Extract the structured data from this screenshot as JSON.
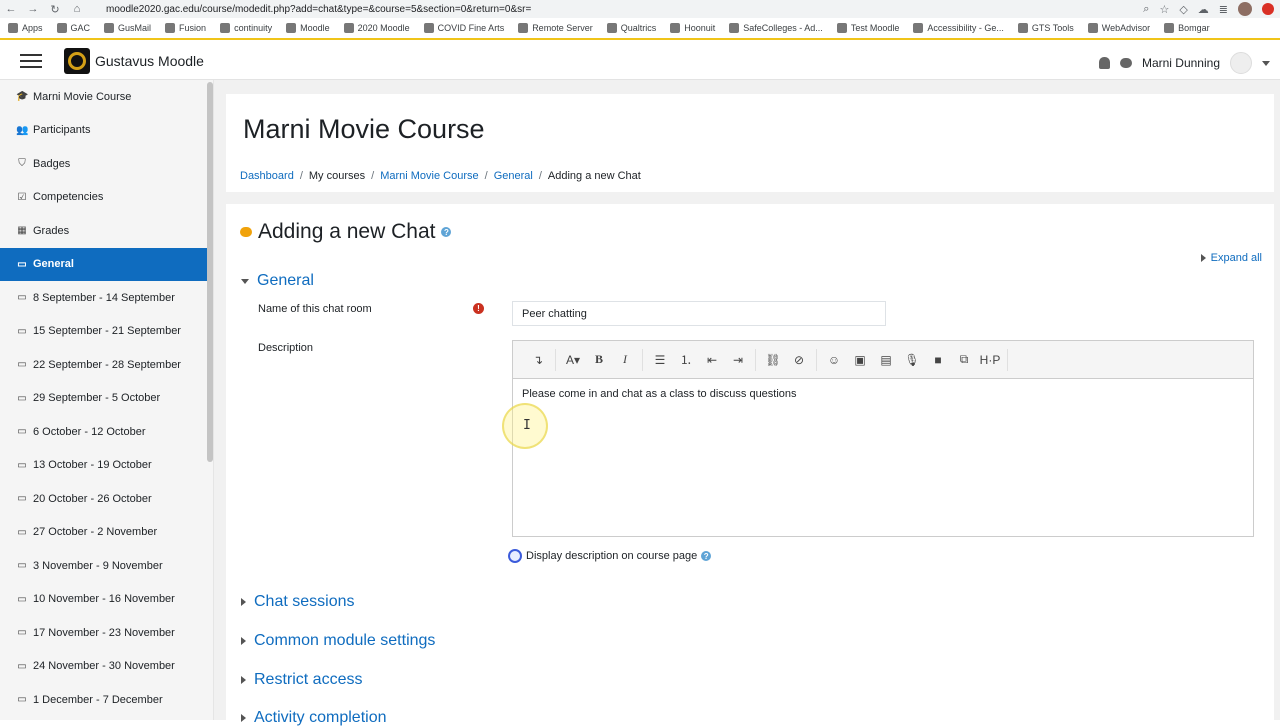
{
  "browser": {
    "url": "moodle2020.gac.edu/course/modedit.php?add=chat&type=&course=5&section=0&return=0&sr=",
    "bookmarks": [
      "Apps",
      "GAC",
      "GusMail",
      "Fusion",
      "continuity",
      "Moodle",
      "2020 Moodle",
      "COVID Fine Arts",
      "Remote Server",
      "Qualtrics",
      "Hoonuit",
      "SafeColleges - Ad...",
      "Test Moodle",
      "Accessibility - Ge...",
      "GTS Tools",
      "WebAdvisor",
      "Bomgar"
    ]
  },
  "navbar": {
    "brand": "Gustavus Moodle",
    "user_name": "Marni Dunning"
  },
  "sidebar": {
    "items": [
      {
        "label": "Marni Movie Course",
        "icon": "graduation-cap-icon",
        "glyph": "🎓"
      },
      {
        "label": "Participants",
        "icon": "users-icon",
        "glyph": "👥"
      },
      {
        "label": "Badges",
        "icon": "shield-icon",
        "glyph": "⛉"
      },
      {
        "label": "Competencies",
        "icon": "checkbox-icon",
        "glyph": "☑"
      },
      {
        "label": "Grades",
        "icon": "table-icon",
        "glyph": "▦"
      },
      {
        "label": "General",
        "icon": "folder-icon",
        "glyph": "▭"
      },
      {
        "label": "8 September - 14 September",
        "icon": "folder-icon",
        "glyph": "▭"
      },
      {
        "label": "15 September - 21 September",
        "icon": "folder-icon",
        "glyph": "▭"
      },
      {
        "label": "22 September - 28 September",
        "icon": "folder-icon",
        "glyph": "▭"
      },
      {
        "label": "29 September - 5 October",
        "icon": "folder-icon",
        "glyph": "▭"
      },
      {
        "label": "6 October - 12 October",
        "icon": "folder-icon",
        "glyph": "▭"
      },
      {
        "label": "13 October - 19 October",
        "icon": "folder-icon",
        "glyph": "▭"
      },
      {
        "label": "20 October - 26 October",
        "icon": "folder-icon",
        "glyph": "▭"
      },
      {
        "label": "27 October - 2 November",
        "icon": "folder-icon",
        "glyph": "▭"
      },
      {
        "label": "3 November - 9 November",
        "icon": "folder-icon",
        "glyph": "▭"
      },
      {
        "label": "10 November - 16 November",
        "icon": "folder-icon",
        "glyph": "▭"
      },
      {
        "label": "17 November - 23 November",
        "icon": "folder-icon",
        "glyph": "▭"
      },
      {
        "label": "24 November - 30 November",
        "icon": "folder-icon",
        "glyph": "▭"
      },
      {
        "label": "1 December - 7 December",
        "icon": "folder-icon",
        "glyph": "▭"
      }
    ],
    "active_index": 5
  },
  "header": {
    "course_title": "Marni Movie Course",
    "breadcrumb": {
      "dashboard": "Dashboard",
      "my_courses": "My courses",
      "course": "Marni Movie Course",
      "section": "General",
      "current": "Adding a new Chat"
    }
  },
  "form": {
    "title": "Adding a new Chat",
    "expand_all": "Expand all",
    "general_section": "General",
    "name_label": "Name of this chat room",
    "name_value": "Peer chatting",
    "description_label": "Description",
    "description_text": "Please come in and chat as a class to discuss questions",
    "display_description_label": "Display description on course page",
    "collapsed_sections": [
      "Chat sessions",
      "Common module settings",
      "Restrict access",
      "Activity completion"
    ]
  },
  "toolbar": {
    "buttons": [
      {
        "name": "toggle-toolbar-icon",
        "glyph": "↴"
      },
      {
        "name": "font-style-icon",
        "glyph": "A▾"
      },
      {
        "name": "bold-icon",
        "glyph": "B"
      },
      {
        "name": "italic-icon",
        "glyph": "I"
      },
      {
        "name": "unordered-list-icon",
        "glyph": "☰"
      },
      {
        "name": "ordered-list-icon",
        "glyph": "⒈"
      },
      {
        "name": "outdent-icon",
        "glyph": "⇤"
      },
      {
        "name": "indent-icon",
        "glyph": "⇥"
      },
      {
        "name": "link-icon",
        "glyph": "⛓"
      },
      {
        "name": "unlink-icon",
        "glyph": "⊘"
      },
      {
        "name": "emoji-icon",
        "glyph": "☺"
      },
      {
        "name": "image-icon",
        "glyph": "▣"
      },
      {
        "name": "media-icon",
        "glyph": "▤"
      },
      {
        "name": "record-audio-icon",
        "glyph": "🎙"
      },
      {
        "name": "record-video-icon",
        "glyph": "■"
      },
      {
        "name": "manage-files-icon",
        "glyph": "⧉"
      },
      {
        "name": "h5p-icon",
        "glyph": "H·P"
      }
    ]
  },
  "colors": {
    "accent": "#0f6cbf",
    "required": "#ca3120",
    "bookmark_border": "#f0c419"
  }
}
